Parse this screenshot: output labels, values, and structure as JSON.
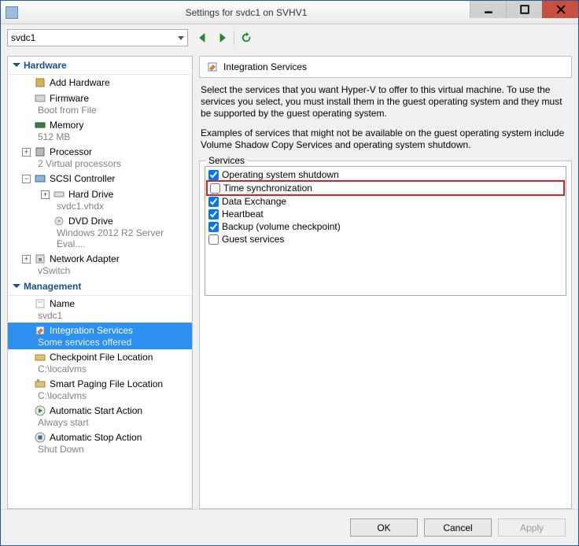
{
  "window": {
    "title": "Settings for svdc1 on SVHV1"
  },
  "toolbar": {
    "vm_name": "svdc1"
  },
  "sections": {
    "hardware": "Hardware",
    "management": "Management"
  },
  "tree": {
    "add_hardware": "Add Hardware",
    "firmware": {
      "label": "Firmware",
      "sub": "Boot from File"
    },
    "memory": {
      "label": "Memory",
      "sub": "512 MB"
    },
    "processor": {
      "label": "Processor",
      "sub": "2 Virtual processors"
    },
    "scsi": {
      "label": "SCSI Controller"
    },
    "hard_drive": {
      "label": "Hard Drive",
      "sub": "svdc1.vhdx"
    },
    "dvd": {
      "label": "DVD Drive",
      "sub": "Windows 2012 R2 Server Eval...."
    },
    "net": {
      "label": "Network Adapter",
      "sub": "vSwitch"
    },
    "name": {
      "label": "Name",
      "sub": "svdc1"
    },
    "integration": {
      "label": "Integration Services",
      "sub": "Some services offered"
    },
    "checkpoint": {
      "label": "Checkpoint File Location",
      "sub": "C:\\localvms"
    },
    "paging": {
      "label": "Smart Paging File Location",
      "sub": "C:\\localvms"
    },
    "autostart": {
      "label": "Automatic Start Action",
      "sub": "Always start"
    },
    "autostop": {
      "label": "Automatic Stop Action",
      "sub": "Shut Down"
    }
  },
  "panel": {
    "title": "Integration Services",
    "desc1": "Select the services that you want Hyper-V to offer to this virtual machine. To use the services you select, you must install them in the guest operating system and they must be supported by the guest operating system.",
    "desc2": "Examples of services that might not be available on the guest operating system include Volume Shadow Copy Services and operating system shutdown.",
    "legend": "Services"
  },
  "services": [
    {
      "label": "Operating system shutdown",
      "checked": true,
      "highlight": false
    },
    {
      "label": "Time synchronization",
      "checked": false,
      "highlight": true
    },
    {
      "label": "Data Exchange",
      "checked": true,
      "highlight": false
    },
    {
      "label": "Heartbeat",
      "checked": true,
      "highlight": false
    },
    {
      "label": "Backup (volume checkpoint)",
      "checked": true,
      "highlight": false
    },
    {
      "label": "Guest services",
      "checked": false,
      "highlight": false
    }
  ],
  "buttons": {
    "ok": "OK",
    "cancel": "Cancel",
    "apply": "Apply"
  }
}
